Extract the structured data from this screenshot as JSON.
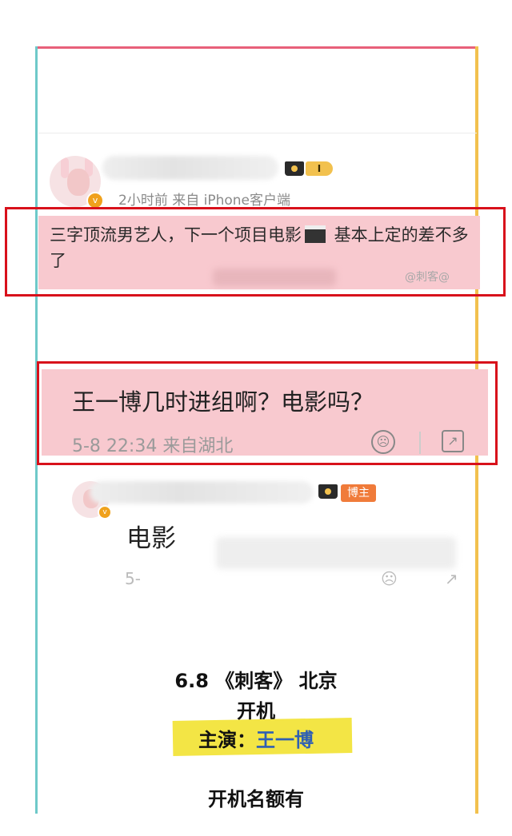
{
  "post": {
    "meta": "2小时前  来自 iPhone客户端",
    "level": "I",
    "text_part1": "三字顶流男艺人，下一个项目电影",
    "text_part2": " 基本上定的差不多了",
    "clapper_icon": "clapperboard-icon",
    "watermark": "@刺客@"
  },
  "comment": {
    "question": "王一博几时进组啊？电影吗？",
    "meta": "5-8 22:34 来自湖北"
  },
  "reply": {
    "badge": "博主",
    "text": "电影",
    "faded_left": "5-",
    "faded_mid": "☹",
    "faded_right": "↗"
  },
  "info": {
    "line1": "6.8 《刺客》 北京",
    "line2": "开机",
    "line3_label": "主演：",
    "line3_name": "王一博",
    "line4": "开机名额有"
  },
  "colors": {
    "frame_top": "#e8607a",
    "frame_left": "#6ec9c9",
    "frame_right": "#f2c14e",
    "highlight_pink": "#f8c9cf",
    "red_box": "#d8111b",
    "marker_yellow": "#f3e545",
    "name_blue": "#2f5fb3"
  }
}
